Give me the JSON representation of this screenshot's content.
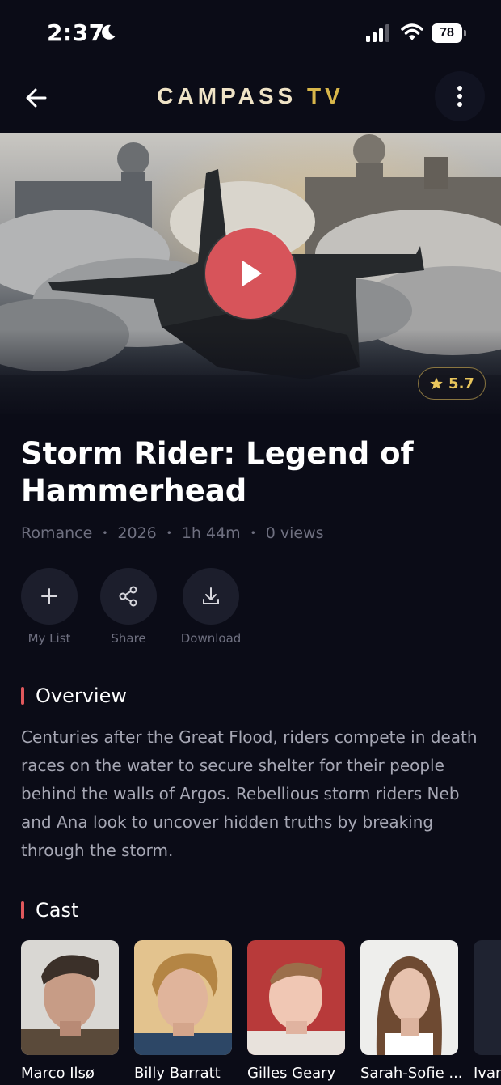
{
  "status_bar": {
    "time": "2:37",
    "battery": "78"
  },
  "app_bar": {
    "title_part1": "CAMPASS",
    "title_part2": "TV"
  },
  "movie": {
    "title": "Storm Rider: Legend of Hammerhead",
    "rating": "5.7",
    "genre": "Romance",
    "year": "2026",
    "duration": "1h 44m",
    "views": "0 views",
    "meta_separator": "•"
  },
  "actions": {
    "my_list": "My List",
    "share": "Share",
    "download": "Download"
  },
  "overview": {
    "heading": "Overview",
    "text": "Centuries after the Great Flood, riders compete in death races on the water to secure shelter for their people behind the walls of Argos. Rebellious storm riders Neb and Ana look to uncover hidden truths by breaking through the storm."
  },
  "cast": {
    "heading": "Cast",
    "members": [
      {
        "name": "Marco Ilsø"
      },
      {
        "name": "Billy Barratt"
      },
      {
        "name": "Gilles Geary"
      },
      {
        "name": "Sarah-Sofie ..."
      },
      {
        "name": "Ivan"
      }
    ]
  },
  "colors": {
    "background": "#0b0c17",
    "accent": "#e0585c",
    "brand_gold": "#d8b64a",
    "play_button": "#d7545a"
  }
}
